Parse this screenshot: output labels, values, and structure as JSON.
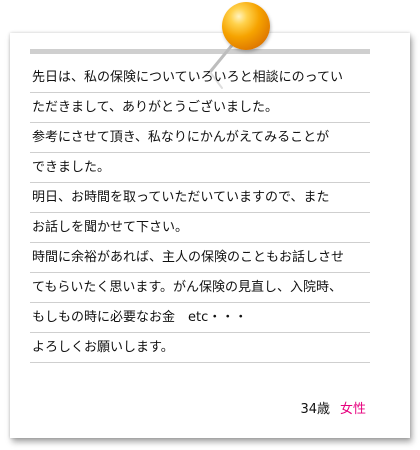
{
  "note": {
    "lines": [
      "先日は、私の保険についていろいろと相談にのってい",
      "ただきまして、ありがとうございました。",
      "参考にさせて頂き、私なりにかんがえてみることが",
      "できました。",
      "明日、お時間を取っていただいていますので、また",
      "お話しを聞かせて下さい。",
      "時間に余裕があれば、主人の保険のこともお話しさせ",
      "てもらいたく思います。がん保険の見直し、入院時、",
      "もしもの時に必要なお金　etc・・・",
      "よろしくお願いします。"
    ],
    "signature": {
      "age": "34歳",
      "gender": "女性"
    }
  },
  "colors": {
    "gender_accent": "#e6007e",
    "pin_head": "#f6a300",
    "rule_line": "#cfcfcf"
  },
  "icons": [
    "pushpin-icon"
  ]
}
